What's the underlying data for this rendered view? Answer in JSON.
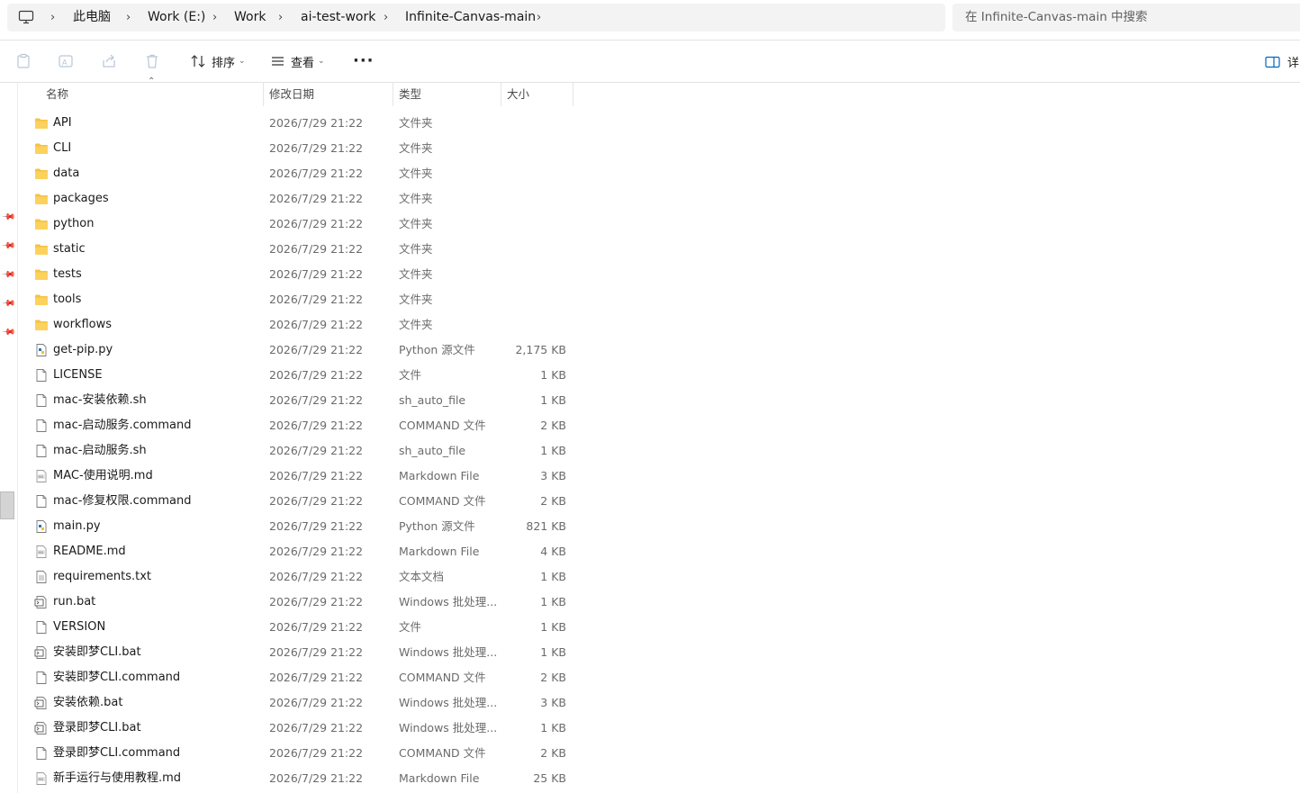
{
  "breadcrumb": {
    "items": [
      "此电脑",
      "Work (E:)",
      "Work",
      "ai-test-work",
      "Infinite-Canvas-main"
    ]
  },
  "search": {
    "placeholder": "在 Infinite-Canvas-main 中搜索"
  },
  "toolbar": {
    "sort_label": "排序",
    "view_label": "查看",
    "details_label": "详"
  },
  "columns": {
    "name": "名称",
    "date": "修改日期",
    "type": "类型",
    "size": "大小"
  },
  "files": [
    {
      "name": "API",
      "date": "2026/7/29 21:22",
      "type": "文件夹",
      "size": "",
      "icon": "folder"
    },
    {
      "name": "CLI",
      "date": "2026/7/29 21:22",
      "type": "文件夹",
      "size": "",
      "icon": "folder"
    },
    {
      "name": "data",
      "date": "2026/7/29 21:22",
      "type": "文件夹",
      "size": "",
      "icon": "folder"
    },
    {
      "name": "packages",
      "date": "2026/7/29 21:22",
      "type": "文件夹",
      "size": "",
      "icon": "folder"
    },
    {
      "name": "python",
      "date": "2026/7/29 21:22",
      "type": "文件夹",
      "size": "",
      "icon": "folder"
    },
    {
      "name": "static",
      "date": "2026/7/29 21:22",
      "type": "文件夹",
      "size": "",
      "icon": "folder"
    },
    {
      "name": "tests",
      "date": "2026/7/29 21:22",
      "type": "文件夹",
      "size": "",
      "icon": "folder"
    },
    {
      "name": "tools",
      "date": "2026/7/29 21:22",
      "type": "文件夹",
      "size": "",
      "icon": "folder"
    },
    {
      "name": "workflows",
      "date": "2026/7/29 21:22",
      "type": "文件夹",
      "size": "",
      "icon": "folder"
    },
    {
      "name": "get-pip.py",
      "date": "2026/7/29 21:22",
      "type": "Python 源文件",
      "size": "2,175 KB",
      "icon": "python"
    },
    {
      "name": "LICENSE",
      "date": "2026/7/29 21:22",
      "type": "文件",
      "size": "1 KB",
      "icon": "file"
    },
    {
      "name": "mac-安装依赖.sh",
      "date": "2026/7/29 21:22",
      "type": "sh_auto_file",
      "size": "1 KB",
      "icon": "file"
    },
    {
      "name": "mac-启动服务.command",
      "date": "2026/7/29 21:22",
      "type": "COMMAND 文件",
      "size": "2 KB",
      "icon": "file"
    },
    {
      "name": "mac-启动服务.sh",
      "date": "2026/7/29 21:22",
      "type": "sh_auto_file",
      "size": "1 KB",
      "icon": "file"
    },
    {
      "name": "MAC-使用说明.md",
      "date": "2026/7/29 21:22",
      "type": "Markdown File",
      "size": "3 KB",
      "icon": "markdown"
    },
    {
      "name": "mac-修复权限.command",
      "date": "2026/7/29 21:22",
      "type": "COMMAND 文件",
      "size": "2 KB",
      "icon": "file"
    },
    {
      "name": "main.py",
      "date": "2026/7/29 21:22",
      "type": "Python 源文件",
      "size": "821 KB",
      "icon": "python"
    },
    {
      "name": "README.md",
      "date": "2026/7/29 21:22",
      "type": "Markdown File",
      "size": "4 KB",
      "icon": "markdown"
    },
    {
      "name": "requirements.txt",
      "date": "2026/7/29 21:22",
      "type": "文本文档",
      "size": "1 KB",
      "icon": "text"
    },
    {
      "name": "run.bat",
      "date": "2026/7/29 21:22",
      "type": "Windows 批处理...",
      "size": "1 KB",
      "icon": "batch"
    },
    {
      "name": "VERSION",
      "date": "2026/7/29 21:22",
      "type": "文件",
      "size": "1 KB",
      "icon": "file"
    },
    {
      "name": "安装即梦CLI.bat",
      "date": "2026/7/29 21:22",
      "type": "Windows 批处理...",
      "size": "1 KB",
      "icon": "batch"
    },
    {
      "name": "安装即梦CLI.command",
      "date": "2026/7/29 21:22",
      "type": "COMMAND 文件",
      "size": "2 KB",
      "icon": "file"
    },
    {
      "name": "安装依赖.bat",
      "date": "2026/7/29 21:22",
      "type": "Windows 批处理...",
      "size": "3 KB",
      "icon": "batch"
    },
    {
      "name": "登录即梦CLI.bat",
      "date": "2026/7/29 21:22",
      "type": "Windows 批处理...",
      "size": "1 KB",
      "icon": "batch"
    },
    {
      "name": "登录即梦CLI.command",
      "date": "2026/7/29 21:22",
      "type": "COMMAND 文件",
      "size": "2 KB",
      "icon": "file"
    },
    {
      "name": "新手运行与使用教程.md",
      "date": "2026/7/29 21:22",
      "type": "Markdown File",
      "size": "25 KB",
      "icon": "markdown"
    }
  ],
  "colors": {
    "folder": "#f5c342",
    "folder_dark": "#e8a918",
    "accent": "#0067c0"
  }
}
